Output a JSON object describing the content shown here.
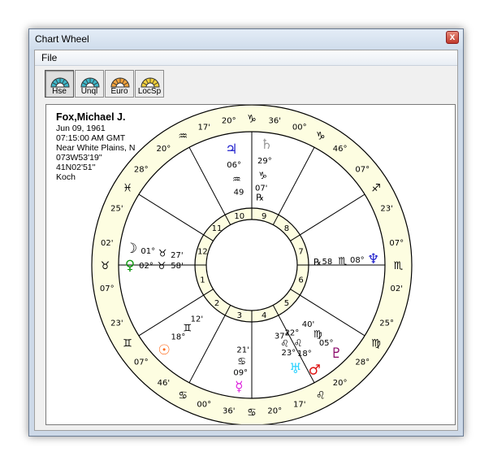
{
  "window": {
    "title": "Chart Wheel",
    "close_glyph": "x"
  },
  "menu": {
    "file": "File"
  },
  "toolbar": [
    {
      "label": "Hse",
      "icon": "house-wheel-icon",
      "color": "#3fb7c9",
      "active": true
    },
    {
      "label": "Unql",
      "icon": "unequal-wheel-icon",
      "color": "#3fb7c9",
      "active": false
    },
    {
      "label": "Euro",
      "icon": "euro-wheel-icon",
      "color": "#f2a23c",
      "active": false
    },
    {
      "label": "LocSp",
      "icon": "local-space-icon",
      "color": "#f2cf3c",
      "active": false
    }
  ],
  "info": {
    "name": "Fox,Michael J.",
    "date": "Jun 09, 1961",
    "time": "07:15:00 AM GMT",
    "place": "Near White Plains, N",
    "longitude": "073W53'19''",
    "latitude": "41N02'51''",
    "house_system": "Koch"
  },
  "colors": {
    "zodiac_band": "#fdfde1",
    "ring": "#000000",
    "text": "#000000",
    "jupiter": "#1e1ecc",
    "saturn": "#999999",
    "venus": "#119911",
    "sun": "#ff6a1a",
    "mercury": "#dd22dd",
    "mars": "#dd1111",
    "uranus": "#2fd3ff",
    "pluto": "#880066",
    "neptune": "#1e1ecc"
  },
  "cusps": [
    {
      "house": "1",
      "sign": "♉",
      "deg": "07°",
      "min": "02'"
    },
    {
      "house": "2",
      "sign": "♊",
      "deg": "07°",
      "min": "23'"
    },
    {
      "house": "3",
      "sign": "♋",
      "deg": "00°",
      "min": "46'"
    },
    {
      "house": "4",
      "sign": "♋",
      "deg": "20°",
      "min": "36'"
    },
    {
      "house": "5",
      "sign": "♌",
      "deg": "20°",
      "min": "17'"
    },
    {
      "house": "6",
      "sign": "♍",
      "deg": "25°",
      "min": "28°"
    },
    {
      "house": "7",
      "sign": "♏",
      "deg": "07°",
      "min": "02'"
    },
    {
      "house": "8",
      "sign": "♐",
      "deg": "07°",
      "min": "23'"
    },
    {
      "house": "9",
      "sign": "♑",
      "deg": "00°",
      "min": "46°"
    },
    {
      "house": "10",
      "sign": "♑",
      "deg": "20°",
      "min": "36'"
    },
    {
      "house": "11",
      "sign": "♒",
      "deg": "20°",
      "min": "17'"
    },
    {
      "house": "12",
      "sign": "♓",
      "deg": "25'",
      "min": "28°"
    }
  ],
  "planets": [
    {
      "name": "Jupiter",
      "glyph": "♃",
      "deg": "06°",
      "sign": "♒",
      "min": "49",
      "color_key": "jupiter"
    },
    {
      "name": "Saturn",
      "glyph": "♄",
      "deg": "29°",
      "sign": "♑",
      "min": "07'",
      "retro": "℞",
      "color_key": "saturn"
    },
    {
      "name": "Moon",
      "glyph": "☽",
      "deg": "01°",
      "sign": "♉",
      "min": "27'",
      "color_key": "ring"
    },
    {
      "name": "Venus",
      "glyph": "♀",
      "deg": "02°",
      "sign": "♉",
      "min": "58'",
      "color_key": "venus"
    },
    {
      "name": "Neptune",
      "glyph": "♆",
      "deg": "08°",
      "sign": "♏",
      "min": "58",
      "retro": "℞",
      "color_key": "neptune"
    },
    {
      "name": "Sun",
      "glyph": "☉",
      "deg": "18°",
      "sign": "♊",
      "min": "12'",
      "color_key": "sun"
    },
    {
      "name": "Mercury",
      "glyph": "☿",
      "deg": "09°",
      "sign": "♋",
      "min": "21'",
      "color_key": "mercury"
    },
    {
      "name": "Mars",
      "glyph": "♂",
      "deg": "18°",
      "sign": "♌",
      "min": "22°",
      "color_key": "mars"
    },
    {
      "name": "Uranus",
      "glyph": "♅",
      "deg": "23°",
      "sign": "♌",
      "min": "37°",
      "color_key": "uranus"
    },
    {
      "name": "Pluto",
      "glyph": "♇",
      "deg": "05°",
      "sign": "♍",
      "min": "40'",
      "color_key": "pluto"
    }
  ]
}
